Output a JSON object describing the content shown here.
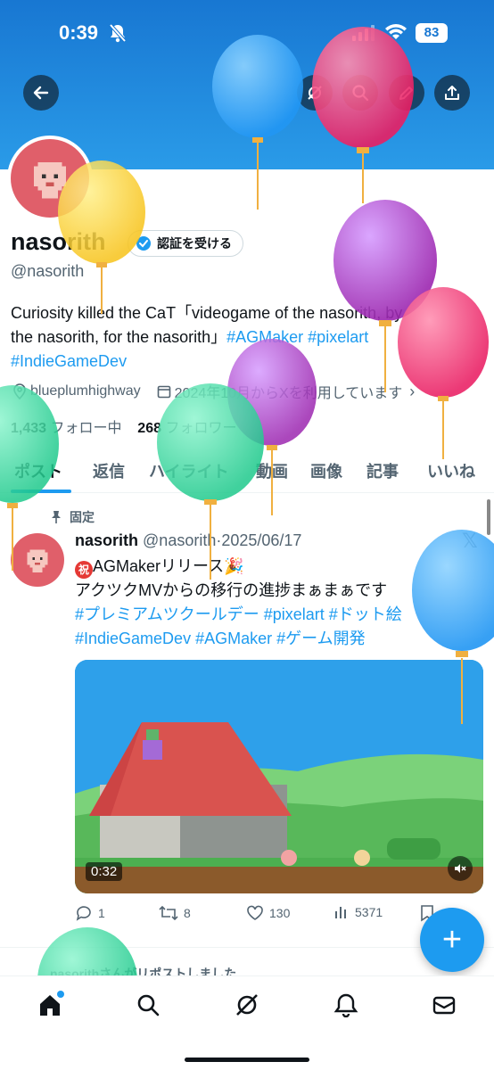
{
  "status_bar": {
    "time": "0:39",
    "battery": "83"
  },
  "profile": {
    "name": "nasorith",
    "verify_label": "認証を受ける",
    "handle": "@nasorith",
    "bio_line1": "Curiosity killed the CaT「videogame of the nasorith, by",
    "bio_line2_a": "the nasorith, for the nasorith」",
    "bio_tags_line2": "#AGMaker #pixelart",
    "bio_line3": "#IndieGameDev",
    "location": "blueplumhighway",
    "joined": "2024年10月からXを利用しています",
    "following_count": "1,433",
    "following_label": "フォロー中",
    "followers_count": "268",
    "followers_label": "フォロワー"
  },
  "tabs": [
    "ポスト",
    "返信",
    "ハイライト",
    "動画",
    "画像",
    "記事",
    "いいね"
  ],
  "post": {
    "pinned_label": "固定",
    "author": "nasorith",
    "handle": "@nasorith",
    "dot": "·",
    "date": "2025/06/17",
    "iwai": "祝",
    "line1": "AGMakerリリース🎉",
    "line2": "アクツクMVからの移行の進捗まぁまぁです",
    "tags1": "#プレミアムツクールデー #pixelart #ドット絵",
    "tags2": "#IndieGameDev #AGMaker #ゲーム開発",
    "video_duration": "0:32",
    "replies": "1",
    "reposts": "8",
    "likes": "130",
    "views": "5371"
  },
  "next_post_note": "nasorithさんがリポストしました",
  "fab_label": "+",
  "colors": {
    "accent": "#1d9bf0",
    "banner": "#1877d2"
  }
}
